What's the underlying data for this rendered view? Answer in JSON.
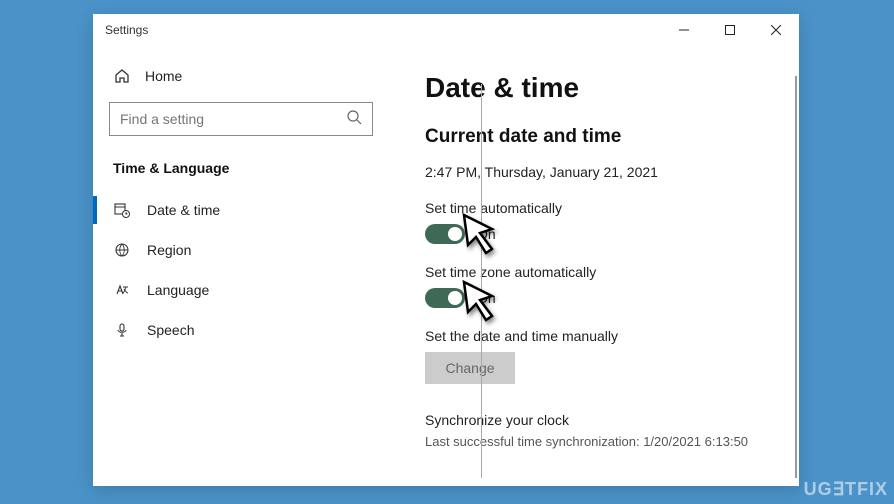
{
  "window": {
    "title": "Settings"
  },
  "sidebar": {
    "home": "Home",
    "searchPlaceholder": "Find a setting",
    "category": "Time & Language",
    "items": [
      {
        "label": "Date & time"
      },
      {
        "label": "Region"
      },
      {
        "label": "Language"
      },
      {
        "label": "Speech"
      }
    ]
  },
  "main": {
    "heading": "Date & time",
    "subheading": "Current date and time",
    "currentDateTime": "2:47 PM, Thursday, January 21, 2021",
    "setTimeAutoLabel": "Set time automatically",
    "setTimeAutoState": "On",
    "setZoneAutoLabel": "Set time zone automatically",
    "setZoneAutoState": "On",
    "manualLabel": "Set the date and time manually",
    "changeBtn": "Change",
    "syncHeading": "Synchronize your clock",
    "syncLast": "Last successful time synchronization: 1/20/2021 6:13:50"
  },
  "watermark": "UG∃TFIX"
}
